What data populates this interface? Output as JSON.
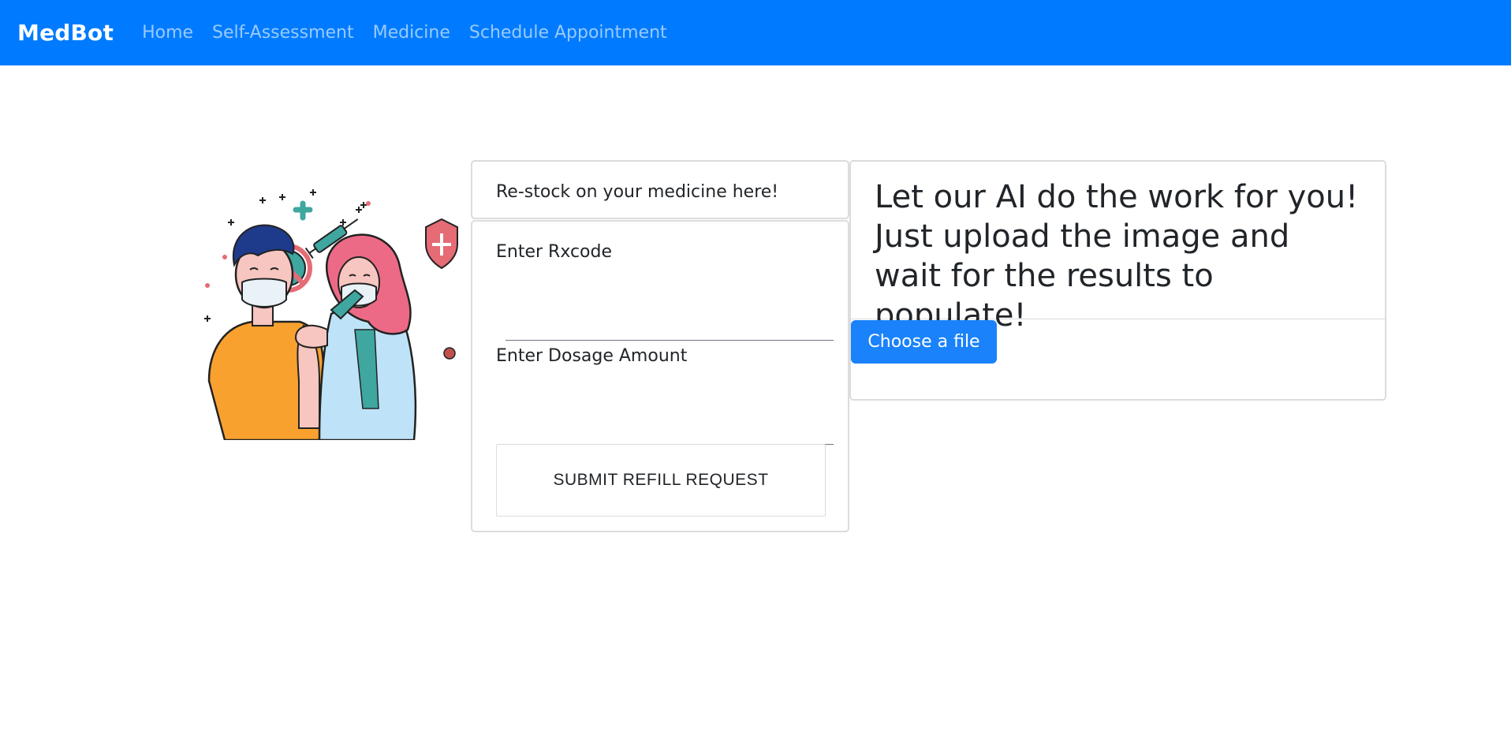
{
  "navbar": {
    "brand": "MedBot",
    "links": [
      {
        "label": "Home"
      },
      {
        "label": "Self-Assessment"
      },
      {
        "label": "Medicine"
      },
      {
        "label": "Schedule Appointment"
      }
    ],
    "background": "#007bff"
  },
  "illustration": {
    "icon": "vaccination-illustration"
  },
  "refill": {
    "header": "Re-stock on your medicine here!",
    "rxcode_label": "Enter Rxcode",
    "rxcode_value": "",
    "dosage_label": "Enter Dosage Amount",
    "dosage_value": "",
    "submit_label": "SUBMIT REFILL REQUEST"
  },
  "ai_upload": {
    "header": "Let our AI do the work for you! Just upload the image and wait for the results to populate!",
    "button_label": "Choose a file",
    "button_color": "#1a82fb"
  }
}
